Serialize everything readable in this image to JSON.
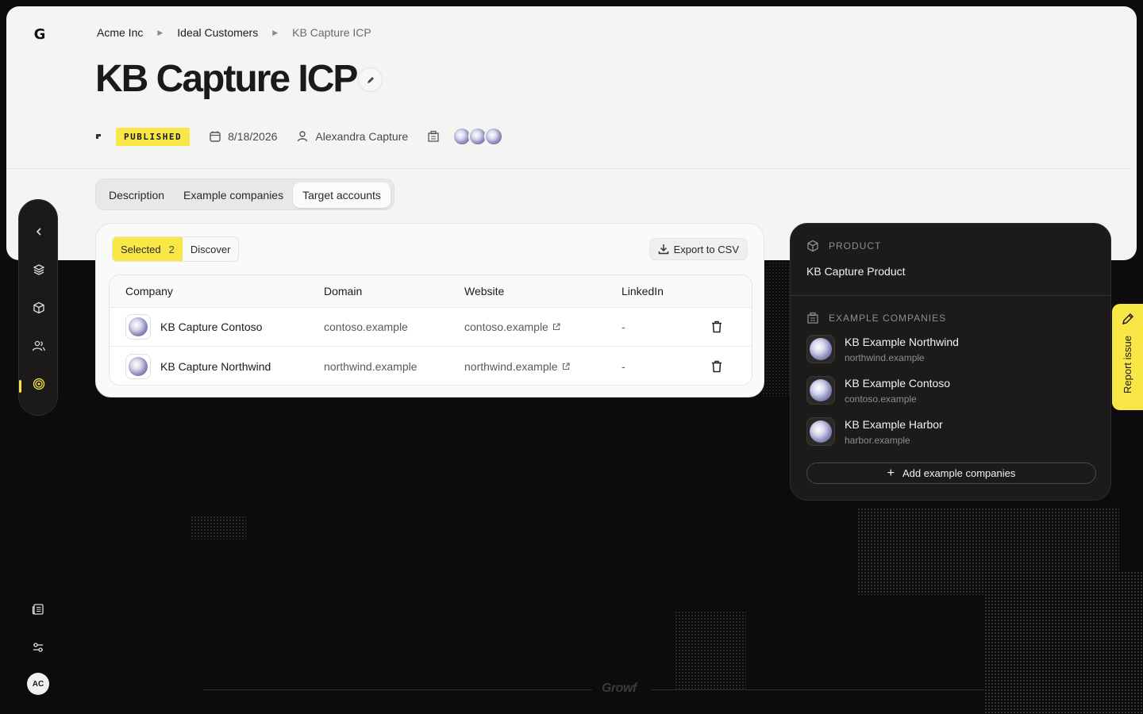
{
  "app": {
    "brand_letter": "G",
    "footer_logo": "Growf"
  },
  "breadcrumb": {
    "items": [
      "Acme Inc",
      "Ideal Customers",
      "KB Capture ICP"
    ]
  },
  "page": {
    "title": "KB Capture ICP"
  },
  "meta": {
    "status": "PUBLISHED",
    "date": "8/18/2026",
    "owner": "Alexandra Capture"
  },
  "tabs": [
    {
      "label": "Description"
    },
    {
      "label": "Example companies"
    },
    {
      "label": "Target accounts"
    }
  ],
  "accounts": {
    "segment_selected": "Selected",
    "selected_count": "2",
    "segment_discover": "Discover",
    "export_label": "Export to CSV",
    "columns": [
      "Company",
      "Domain",
      "Website",
      "LinkedIn"
    ],
    "rows": [
      {
        "company": "KB Capture Contoso",
        "domain": "contoso.example",
        "website": "contoso.example",
        "linkedin": "-"
      },
      {
        "company": "KB Capture Northwind",
        "domain": "northwind.example",
        "website": "northwind.example",
        "linkedin": "-"
      }
    ]
  },
  "side_panel": {
    "product_heading": "PRODUCT",
    "product_name": "KB Capture Product",
    "examples_heading": "EXAMPLE COMPANIES",
    "examples": [
      {
        "name": "KB Example Northwind",
        "domain": "northwind.example"
      },
      {
        "name": "KB Example Contoso",
        "domain": "contoso.example"
      },
      {
        "name": "KB Example Harbor",
        "domain": "harbor.example"
      }
    ],
    "add_label": "Add example companies"
  },
  "report": {
    "label": "Report issue"
  },
  "user": {
    "initials": "AC"
  },
  "colors": {
    "accent": "#f8e746",
    "dark_bg": "#0d0c0c",
    "panel_dark": "#1c1b1a",
    "light_panel": "#f4f4f3"
  },
  "icons": {
    "rail": [
      "chevron-left-icon",
      "layers-icon",
      "cube-icon",
      "users-icon",
      "target-icon"
    ],
    "bottom": [
      "news-icon",
      "sliders-icon"
    ]
  }
}
